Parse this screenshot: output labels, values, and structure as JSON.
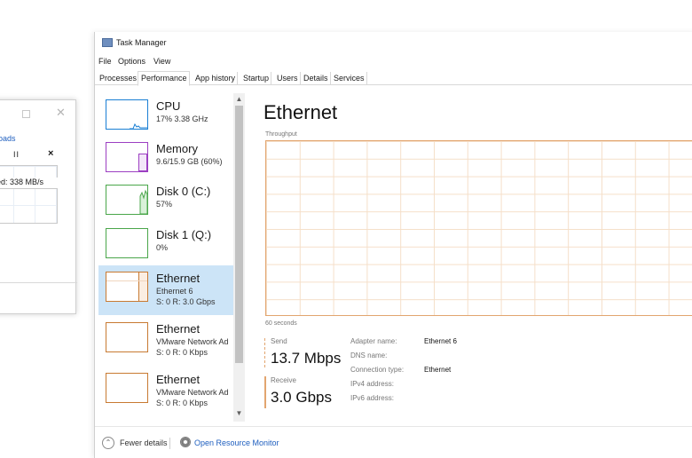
{
  "background_window": {
    "downloads_link": "nloads",
    "pause_label": "II",
    "cancel_label": "×",
    "speed_text": "eed: 338 MB/s"
  },
  "window": {
    "title": "Task Manager",
    "menu": [
      "File",
      "Options",
      "View"
    ],
    "tabs": [
      "Processes",
      "Performance",
      "App history",
      "Startup",
      "Users",
      "Details",
      "Services"
    ],
    "active_tab": "Performance"
  },
  "sidebar": {
    "items": [
      {
        "name": "CPU",
        "sub1": "17%  3.38 GHz",
        "sub2": "",
        "color": "#1a7fd4"
      },
      {
        "name": "Memory",
        "sub1": "9.6/15.9 GB (60%)",
        "sub2": "",
        "color": "#9c3fc2"
      },
      {
        "name": "Disk 0 (C:)",
        "sub1": "57%",
        "sub2": "",
        "color": "#4aa64a"
      },
      {
        "name": "Disk 1 (Q:)",
        "sub1": "0%",
        "sub2": "",
        "color": "#4aa64a"
      },
      {
        "name": "Ethernet",
        "sub1": "Ethernet 6",
        "sub2": "S: 0  R: 3.0 Gbps",
        "color": "#c87a32"
      },
      {
        "name": "Ethernet",
        "sub1": "VMware Network Ad",
        "sub2": "S: 0  R: 0 Kbps",
        "color": "#c87a32"
      },
      {
        "name": "Ethernet",
        "sub1": "VMware Network Ad",
        "sub2": "S: 0  R: 0 Kbps",
        "color": "#c87a32"
      }
    ],
    "selected_index": 4
  },
  "detail": {
    "title": "Ethernet",
    "graph_label": "Throughput",
    "time_label": "60 seconds",
    "send_label": "Send",
    "send_value": "13.7 Mbps",
    "receive_label": "Receive",
    "receive_value": "3.0 Gbps",
    "info": [
      {
        "label": "Adapter name:",
        "value": "Ethernet 6"
      },
      {
        "label": "DNS name:",
        "value": ""
      },
      {
        "label": "Connection type:",
        "value": "Ethernet"
      },
      {
        "label": "IPv4 address:",
        "value": ""
      },
      {
        "label": "IPv6 address:",
        "value": ""
      }
    ]
  },
  "footer": {
    "fewer_details": "Fewer details",
    "open_resource_monitor": "Open Resource Monitor"
  }
}
